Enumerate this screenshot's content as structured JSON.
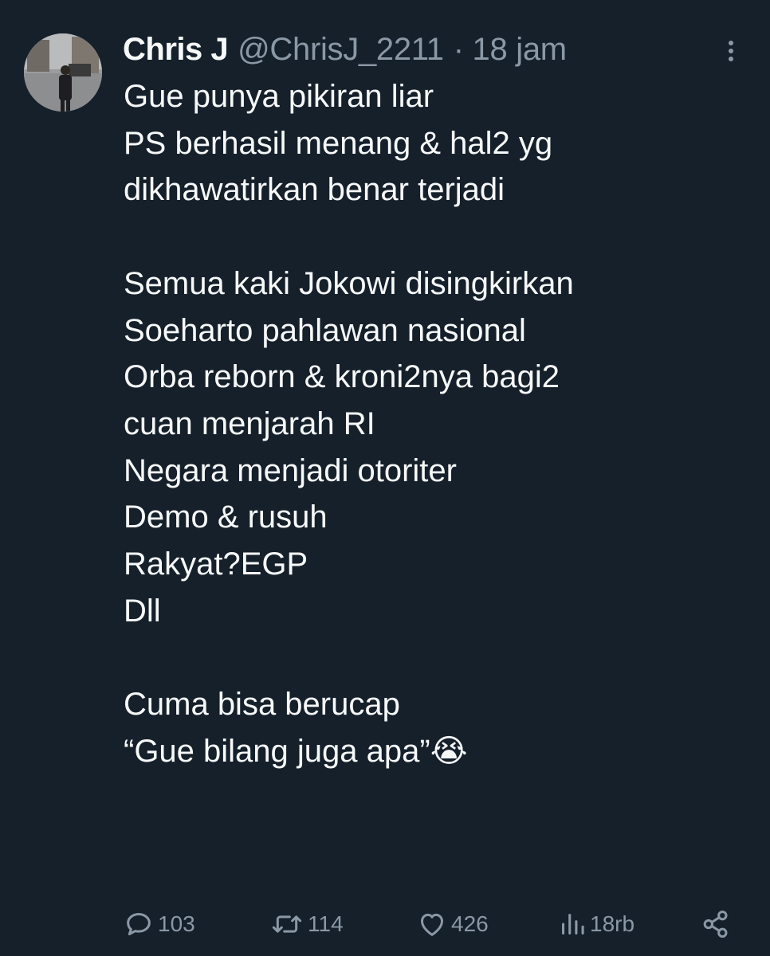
{
  "tweet": {
    "author_name": "Chris J",
    "author_handle": "@ChrisJ_2211",
    "timestamp": "· 18 jam",
    "text": "Gue punya pikiran liar\nPS berhasil menang & hal2 yg\ndikhawatirkan benar terjadi\n\nSemua kaki Jokowi disingkirkan\nSoeharto pahlawan nasional\nOrba reborn & kroni2nya bagi2\ncuan menjarah RI\nNegara menjadi otoriter\nDemo & rusuh\nRakyat?EGP\nDll\n\nCuma bisa berucap\n“Gue bilang juga apa”😭",
    "more_icon": "more-vertical-icon"
  },
  "actions": {
    "replies": "103",
    "reposts": "114",
    "likes": "426",
    "views": "18rb"
  },
  "colors": {
    "background": "#15202b",
    "text": "#f7f9f9",
    "secondary": "#8b98a5"
  }
}
